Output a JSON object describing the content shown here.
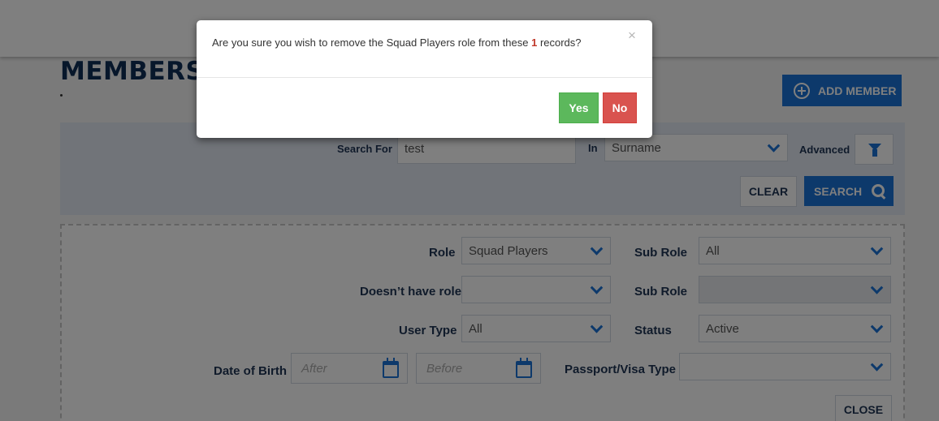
{
  "page": {
    "title": "MEMBERS D",
    "add_member_label": "ADD MEMBER"
  },
  "search": {
    "search_for_label": "Search For",
    "search_for_value": "test",
    "in_label": "In",
    "in_value": "Surname",
    "advanced_label": "Advanced",
    "clear_label": "CLEAR",
    "search_label": "SEARCH"
  },
  "advanced": {
    "role_label": "Role",
    "role_value": "Squad Players",
    "sub_role_label": "Sub Role",
    "sub_role_value": "All",
    "doesnt_have_role_label": "Doesn’t have role",
    "doesnt_have_role_value": "",
    "sub_role2_label": "Sub Role",
    "sub_role2_value": "",
    "user_type_label": "User Type",
    "user_type_value": "All",
    "status_label": "Status",
    "status_value": "Active",
    "dob_label": "Date of Birth",
    "dob_after_placeholder": "After",
    "dob_before_placeholder": "Before",
    "passport_label": "Passport/Visa Type",
    "passport_value": "",
    "close_label": "CLOSE"
  },
  "modal": {
    "message_prefix": "Are you sure you wish to remove the Squad Players role from these ",
    "count": "1",
    "message_suffix": " records?",
    "close_glyph": "×",
    "yes_label": "Yes",
    "no_label": "No"
  }
}
